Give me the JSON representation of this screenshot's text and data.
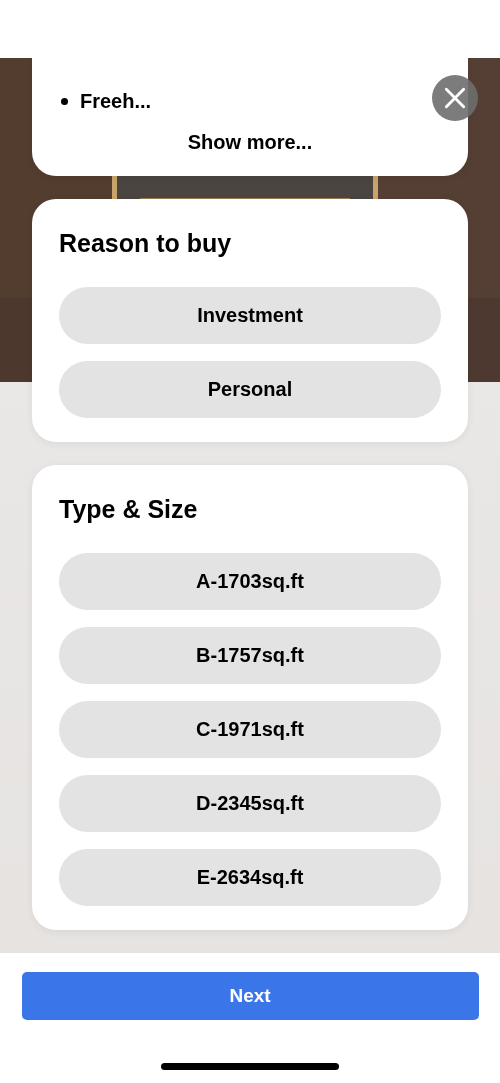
{
  "details_card": {
    "bullets": [
      "Freeh..."
    ],
    "show_more": "Show more..."
  },
  "sections": [
    {
      "title": "Reason to buy",
      "options": [
        {
          "label": "Investment",
          "selected": false
        },
        {
          "label": "Personal",
          "selected": false
        }
      ]
    },
    {
      "title": "Type & Size",
      "options": [
        {
          "label": "A-1703sq.ft",
          "selected": false
        },
        {
          "label": "B-1757sq.ft",
          "selected": false
        },
        {
          "label": "C-1971sq.ft",
          "selected": false
        },
        {
          "label": "D-2345sq.ft",
          "selected": false
        },
        {
          "label": "E-2634sq.ft",
          "selected": false
        }
      ]
    }
  ],
  "next_button": "Next"
}
